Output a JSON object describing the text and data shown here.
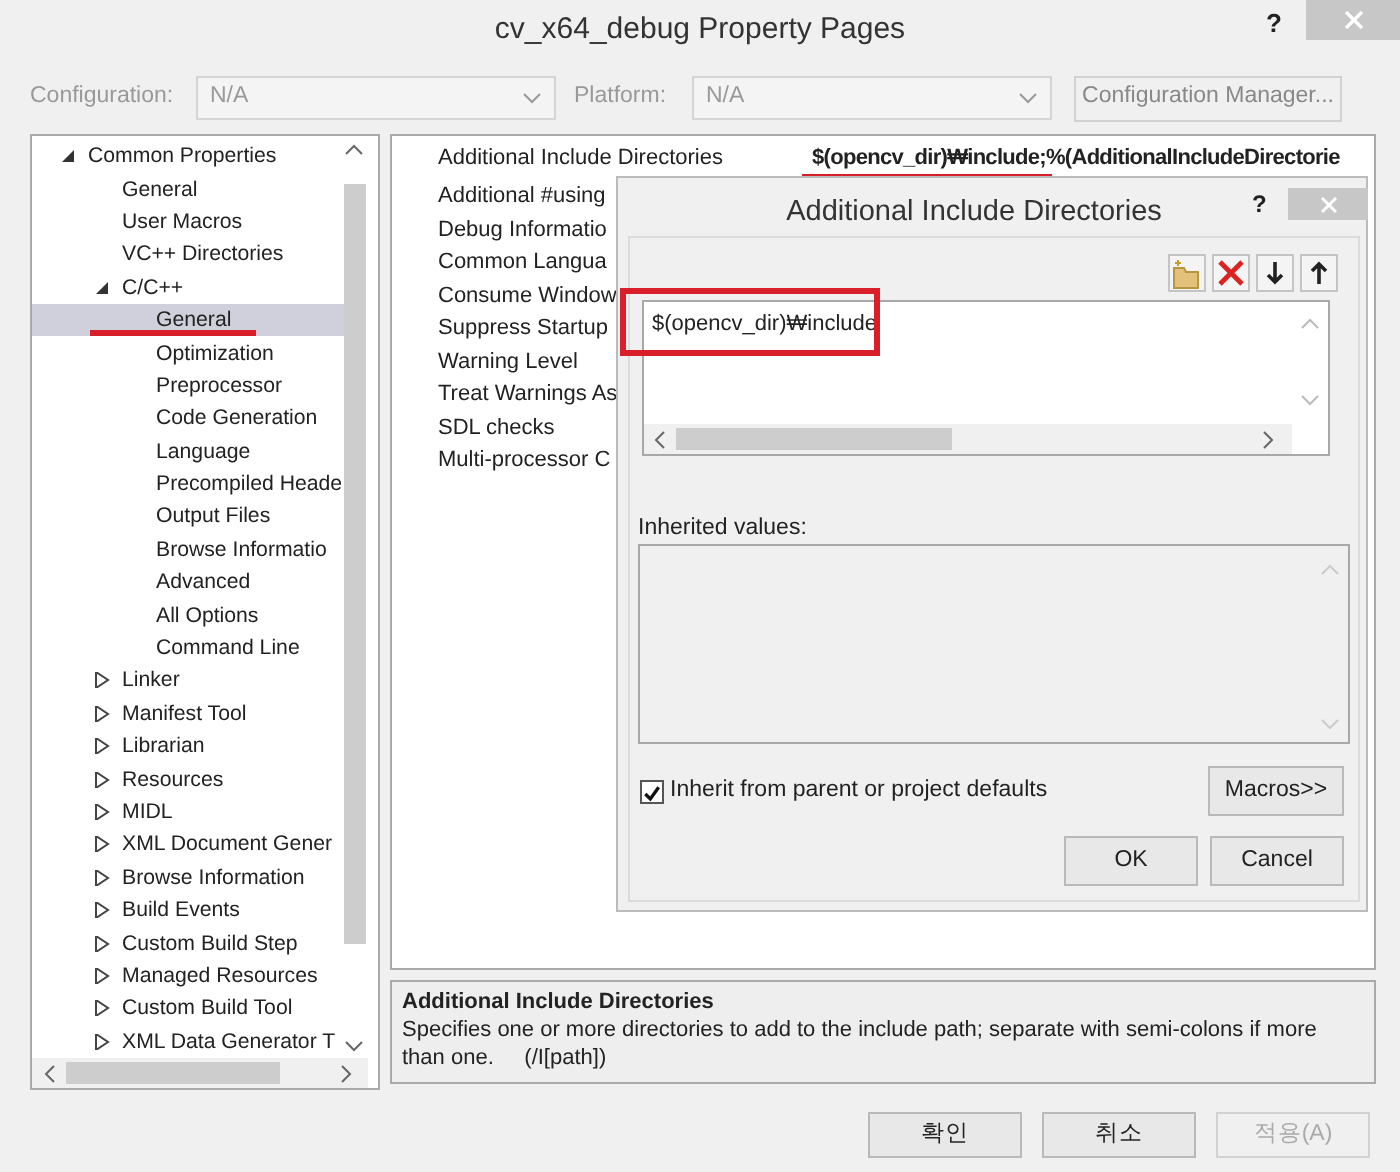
{
  "window": {
    "title": "cv_x64_debug Property Pages",
    "help": "?"
  },
  "config_bar": {
    "configuration_label": "Configuration:",
    "configuration_value": "N/A",
    "platform_label": "Platform:",
    "platform_value": "N/A",
    "manager_button": "Configuration Manager...",
    "disabled": true
  },
  "tree": [
    {
      "label": "Common Properties",
      "expanded": true,
      "selected": false,
      "marked": false,
      "children": [
        {
          "label": "General",
          "selected": false,
          "marked": false
        },
        {
          "label": "User Macros",
          "selected": false,
          "marked": false
        },
        {
          "label": "VC++ Directories",
          "selected": false,
          "marked": false
        },
        {
          "label": "C/C++",
          "expanded": true,
          "selected": false,
          "marked": false,
          "children": [
            {
              "label": "General",
              "selected": true,
              "marked": true
            },
            {
              "label": "Optimization",
              "selected": false,
              "marked": false
            },
            {
              "label": "Preprocessor",
              "selected": false,
              "marked": false
            },
            {
              "label": "Code Generation",
              "selected": false,
              "marked": false
            },
            {
              "label": "Language",
              "selected": false,
              "marked": false
            },
            {
              "label": "Precompiled Heade",
              "selected": false,
              "marked": false
            },
            {
              "label": "Output Files",
              "selected": false,
              "marked": false
            },
            {
              "label": "Browse Informatio",
              "selected": false,
              "marked": false
            },
            {
              "label": "Advanced",
              "selected": false,
              "marked": false
            },
            {
              "label": "All Options",
              "selected": false,
              "marked": false
            },
            {
              "label": "Command Line",
              "selected": false,
              "marked": false
            }
          ]
        },
        {
          "label": "Linker",
          "expanded": false,
          "selected": false,
          "marked": false
        },
        {
          "label": "Manifest Tool",
          "expanded": false,
          "selected": false,
          "marked": false
        },
        {
          "label": "Librarian",
          "expanded": false,
          "selected": false,
          "marked": false
        },
        {
          "label": "Resources",
          "expanded": false,
          "selected": false,
          "marked": false
        },
        {
          "label": "MIDL",
          "expanded": false,
          "selected": false,
          "marked": false
        },
        {
          "label": "XML Document Gener",
          "expanded": false,
          "selected": false,
          "marked": false
        },
        {
          "label": "Browse Information",
          "expanded": false,
          "selected": false,
          "marked": false
        },
        {
          "label": "Build Events",
          "expanded": false,
          "selected": false,
          "marked": false
        },
        {
          "label": "Custom Build Step",
          "expanded": false,
          "selected": false,
          "marked": false
        },
        {
          "label": "Managed Resources",
          "expanded": false,
          "selected": false,
          "marked": false
        },
        {
          "label": "Custom Build Tool",
          "expanded": false,
          "selected": false,
          "marked": false
        },
        {
          "label": "XML Data Generator T",
          "expanded": false,
          "selected": false,
          "marked": false
        }
      ]
    }
  ],
  "properties": [
    {
      "name": "Additional Include Directories",
      "value": "$(opencv_dir)₩include;%(AdditionalIncludeDirectorie",
      "marked": true
    },
    {
      "name": "Additional #using",
      "marked": false
    },
    {
      "name": "Debug Informatio",
      "marked": false
    },
    {
      "name": "Common Langua",
      "marked": false
    },
    {
      "name": "Consume Window",
      "marked": false
    },
    {
      "name": "Suppress Startup",
      "marked": false
    },
    {
      "name": "Warning Level",
      "marked": false
    },
    {
      "name": "Treat Warnings As",
      "marked": false
    },
    {
      "name": "SDL checks",
      "marked": false
    },
    {
      "name": "Multi-processor C",
      "marked": false
    }
  ],
  "description": {
    "title": "Additional Include Directories",
    "text": "Specifies one or more directories to add to the include path; separate with semi-colons if more than one.     (/I[path])"
  },
  "buttons": [
    {
      "label": "확인",
      "disabled": false
    },
    {
      "label": "취소",
      "disabled": false
    },
    {
      "label": "적용(A)",
      "disabled": true
    }
  ],
  "dialog": {
    "title": "Additional Include Directories",
    "help": "?",
    "entries": [
      {
        "text": "$(opencv_dir)₩include",
        "marked": true
      }
    ],
    "inherited_label": "Inherited values:",
    "inherit_checkbox": {
      "label": "Inherit from parent or project defaults",
      "checked": true
    },
    "macros_button": "Macros>>",
    "ok_button": "OK",
    "cancel_button": "Cancel"
  }
}
